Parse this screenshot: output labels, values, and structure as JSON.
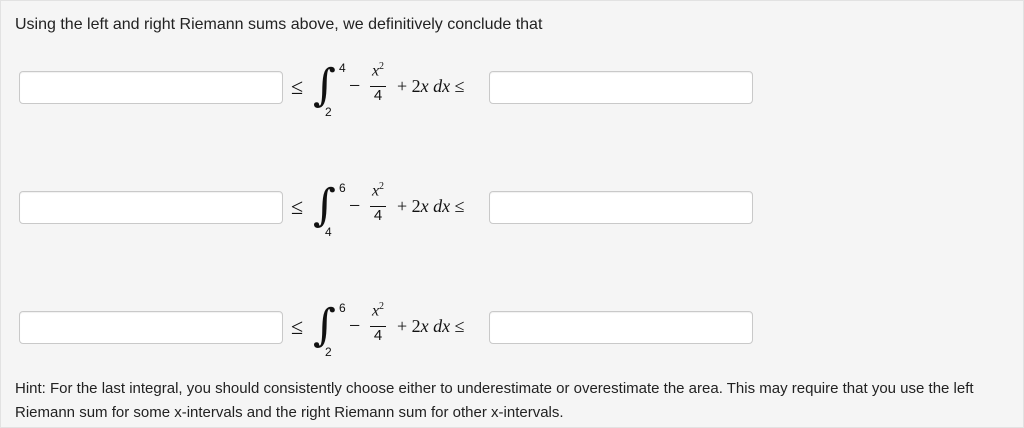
{
  "intro": "Using the left and right Riemann sums above, we definitively conclude that",
  "rows": [
    {
      "lower": "2",
      "upper": "4",
      "minus": "−",
      "numerator_var": "x",
      "numerator_exp": "2",
      "denominator": "4",
      "rest_plus": "+ 2",
      "rest_var": "x",
      "rest_dx": "dx",
      "leq": "≤",
      "left_value": "",
      "right_value": ""
    },
    {
      "lower": "4",
      "upper": "6",
      "minus": "−",
      "numerator_var": "x",
      "numerator_exp": "2",
      "denominator": "4",
      "rest_plus": "+ 2",
      "rest_var": "x",
      "rest_dx": "dx",
      "leq": "≤",
      "left_value": "",
      "right_value": ""
    },
    {
      "lower": "2",
      "upper": "6",
      "minus": "−",
      "numerator_var": "x",
      "numerator_exp": "2",
      "denominator": "4",
      "rest_plus": "+ 2",
      "rest_var": "x",
      "rest_dx": "dx",
      "leq": "≤",
      "left_value": "",
      "right_value": ""
    }
  ],
  "hint": "Hint: For the last integral, you should consistently choose either to underestimate or overestimate the area. This may require that you use the left Riemann sum for some x-intervals and the right Riemann sum for other x-intervals."
}
